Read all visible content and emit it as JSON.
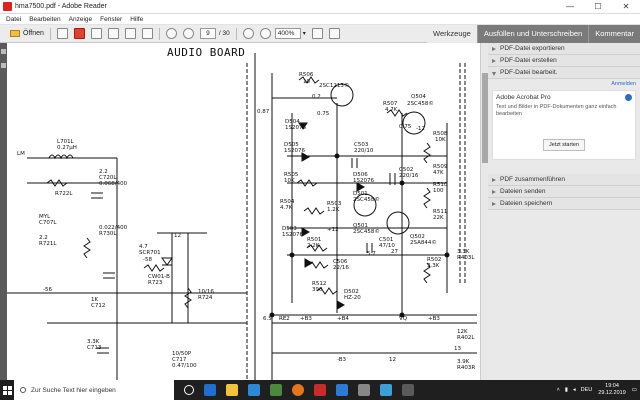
{
  "window": {
    "title": "hma7500.pdf - Adobe Reader",
    "min": "—",
    "max": "☐",
    "close": "✕"
  },
  "menu": [
    "Datei",
    "Bearbeiten",
    "Anzeige",
    "Fenster",
    "Hilfe"
  ],
  "toolbar": {
    "open_label": "Öffnen",
    "page_current": "9",
    "page_total": "/ 30",
    "zoom": "400%",
    "tools_label": "Werkzeuge",
    "fill_sign_label": "Ausfüllen und Unterschreiben",
    "comment_label": "Kommentar"
  },
  "schematic": {
    "heading": "AUDIO BOARD",
    "labels": [
      "R506",
      "10",
      "2SC1213©",
      "0.87",
      "0.2",
      "0.75",
      "R507",
      "4.7K",
      "Q504",
      "2SC458©",
      "D504",
      "1S2076",
      "0.75",
      "R508",
      "10K",
      "D505",
      "1S2076",
      "C503",
      "220/10",
      "R509",
      "47K",
      "R505",
      "10K",
      "D506",
      "1S2076",
      "C502",
      "220/16",
      "R510",
      "100",
      "R504",
      "4.7K",
      "R503",
      "1.2K",
      "D501",
      "2SC458©",
      "R511",
      "22K",
      "D503",
      "1S2076",
      "Q501",
      "2SC458©",
      "Q502",
      "2SA844©",
      "R501",
      "2.2K",
      "C501",
      "47/10",
      "R502",
      "3.3K",
      "R512",
      "390",
      "D502",
      "HZ-20",
      "C506",
      "22/16",
      "L701L",
      "0.27μH",
      "R722L",
      "2.2",
      "C720L",
      "0.068/400",
      "MYL",
      "C707L",
      "0.022/400",
      "R730L",
      "2.2",
      "R721L",
      "4.7",
      "SCR701",
      "CW01-B",
      "R723",
      "1K",
      "C712",
      "10/16",
      "R724",
      "3.3K",
      "R403L",
      "12K",
      "R402L",
      "3.9K",
      "R403R",
      "3.3K",
      "C713",
      "10/50P",
      "C717",
      "0.47/100",
      "-56",
      "-58",
      "12",
      "-12",
      "+12",
      "5.7",
      "27",
      "6.5",
      "RE2",
      "+B3",
      "+B4",
      "VQ",
      "+B3",
      "-B3",
      "12",
      "13",
      "LM"
    ]
  },
  "panel": {
    "sections_top": [
      "PDF-Datei exportieren",
      "PDF-Datei erstellen",
      "PDF-Datei bearbeit."
    ],
    "link": "Anmelden",
    "acrobat": {
      "title": "Adobe Acrobat Pro",
      "desc": "Text und Bilder in PDF-Dokumenten ganz einfach bearbeiten",
      "button": "Jetzt starten"
    },
    "sections_bottom": [
      "PDF zusammenführen",
      "Dateien senden",
      "Dateien speichern"
    ]
  },
  "taskbar": {
    "search_placeholder": "Zur Suche Text hier eingeben",
    "lang": "DEU",
    "time": "19:04",
    "date": "29.12.2019"
  },
  "colors": {
    "taskbar": "#1f1f1f",
    "panel": "#e9e9e9",
    "toolbar": "#ececec",
    "accent": "#2a6bc8"
  }
}
